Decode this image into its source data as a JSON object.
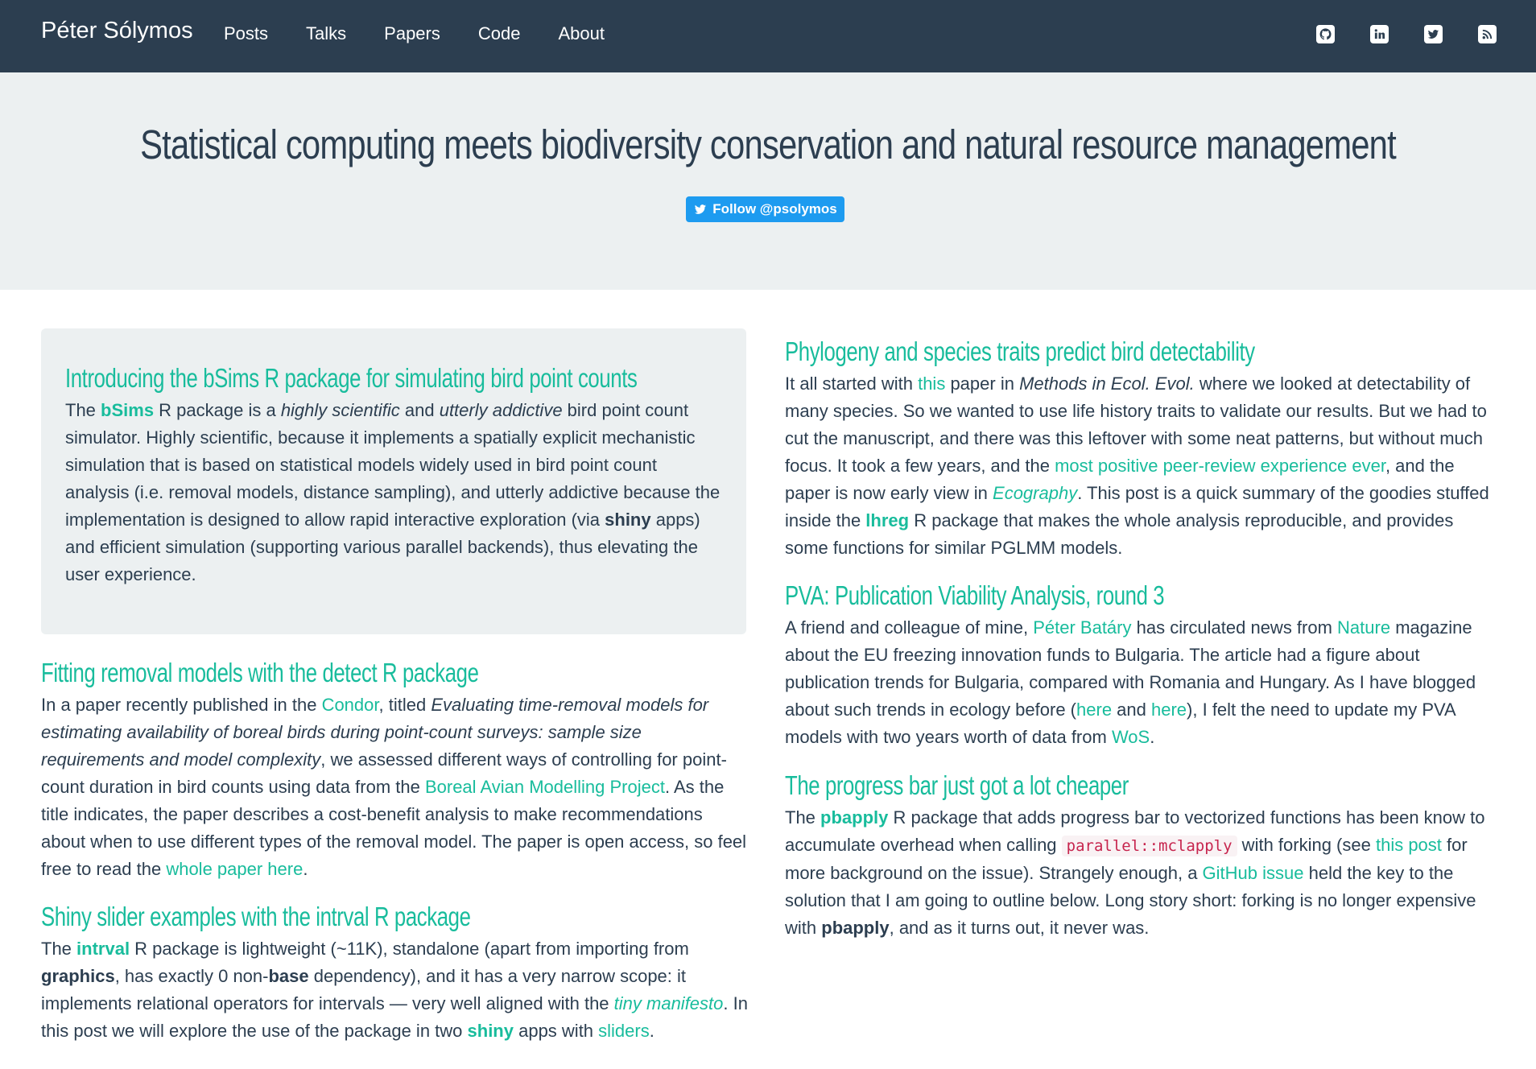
{
  "nav": {
    "brand": "Péter Sólymos",
    "links": [
      "Posts",
      "Talks",
      "Papers",
      "Code",
      "About"
    ],
    "social_icons": [
      "github-icon",
      "linkedin-icon",
      "twitter-icon",
      "rss-icon"
    ]
  },
  "hero": {
    "title": "Statistical computing meets biodiversity conservation and natural resource management",
    "follow_label": "Follow @psolymos"
  },
  "colors": {
    "navbar": "#2c3e50",
    "accent": "#18bc9c",
    "hero_bg": "#ecf0f1",
    "twitter": "#1d9bf0"
  },
  "posts": [
    {
      "title": "Introducing the bSims R package for simulating bird point counts",
      "t": {
        "a": "The ",
        "b": "bSims",
        "c": " R package is a ",
        "d": "highly scientific",
        "e": " and ",
        "f": "utterly addictive",
        "g": " bird point count simulator. Highly scientific, because it implements a spatially explicit mechanistic simulation that is based on statistical models widely used in bird point count analysis (i.e. removal models, distance sampling), and utterly addictive because the implementation is designed to allow rapid interactive exploration (via ",
        "h": "shiny",
        "i": " apps) and efficient simulation (supporting various parallel backends), thus elevating the user experience."
      }
    },
    {
      "title": "Fitting removal models with the detect R package",
      "t": {
        "a": "In a paper recently published in the ",
        "b": "Condor",
        "c": ", titled ",
        "d": "Evaluating time-removal models for estimating availability of boreal birds during point-count surveys: sample size requirements and model complexity",
        "e": ", we assessed different ways of controlling for point-count duration in bird counts using data from the ",
        "f": "Boreal Avian Modelling Project",
        "g": ". As the title indicates, the paper describes a cost-benefit analysis to make recommendations about when to use different types of the removal model. The paper is open access, so feel free to read the ",
        "h": "whole paper here",
        "i": "."
      }
    },
    {
      "title": "Shiny slider examples with the intrval R package",
      "t": {
        "a": "The ",
        "b": "intrval",
        "c": " R package is lightweight (~11K), standalone (apart from importing from ",
        "d": "graphics",
        "e": ", has exactly 0 non-",
        "f": "base",
        "g": " dependency), and it has a very narrow scope: it implements relational operators for intervals — very well aligned with the ",
        "h": "tiny manifesto",
        "i": ". In this post we will explore the use of the package in two ",
        "j": "shiny",
        "k": " apps with ",
        "l": "sliders",
        "m": "."
      }
    },
    {
      "title": "Phylogeny and species traits predict bird detectability",
      "t": {
        "a": "It all started with ",
        "b": "this",
        "c": " paper in ",
        "d": "Methods in Ecol. Evol.",
        "e": " where we looked at detectability of many species. So we wanted to use life history traits to validate our results. But we had to cut the manuscript, and there was this leftover with some neat patterns, but without much focus. It took a few years, and the ",
        "f": "most positive peer-review experience ever",
        "g": ", and the paper is now early view in ",
        "h": "Ecography",
        "i": ". This post is a quick summary of the goodies stuffed inside the ",
        "j": "lhreg",
        "k": " R package that makes the whole analysis reproducible, and provides some functions for similar PGLMM models."
      }
    },
    {
      "title": "PVA: Publication Viability Analysis, round 3",
      "t": {
        "a": "A friend and colleague of mine, ",
        "b": "Péter Batáry",
        "c": " has circulated news from ",
        "d": "Nature",
        "e": " magazine about the EU freezing innovation funds to Bulgaria. The article had a figure about publication trends for Bulgaria, compared with Romania and Hungary. As I have blogged about such trends in ecology before (",
        "f": "here",
        "g": " and ",
        "h": "here",
        "i": "), I felt the need to update my PVA models with two years worth of data from ",
        "j": "WoS",
        "k": "."
      }
    },
    {
      "title": "The progress bar just got a lot cheaper",
      "t": {
        "a": "The ",
        "b": "pbapply",
        "c": " R package that adds progress bar to vectorized functions has been know to accumulate overhead when calling ",
        "d": "parallel::mclapply",
        "e": " with forking (see ",
        "f": "this post",
        "g": " for more background on the issue). Strangely enough, a ",
        "h": "GitHub issue",
        "i": " held the key to the solution that I am going to outline below. Long story short: forking is no longer expensive with ",
        "j": "pbapply",
        "k": ", and as it turns out, it never was."
      }
    }
  ]
}
